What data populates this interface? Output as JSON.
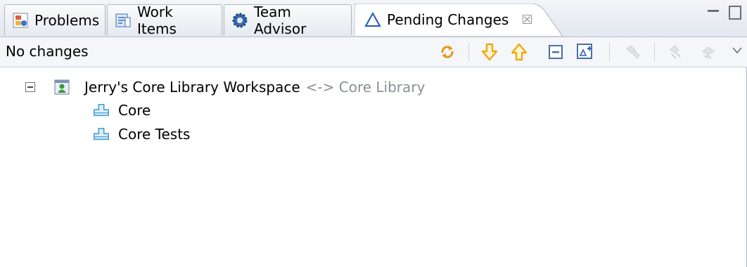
{
  "tabs": [
    {
      "label": "Problems",
      "icon": "problems-icon",
      "active": false
    },
    {
      "label": "Work Items",
      "icon": "work-items-icon",
      "active": false
    },
    {
      "label": "Team Advisor",
      "icon": "gear-icon",
      "active": false
    },
    {
      "label": "Pending Changes",
      "icon": "delta-icon",
      "active": true
    }
  ],
  "active_tab_close": "☒",
  "toolbar": {
    "status": "No changes",
    "buttons": [
      "refresh-icon",
      "accept-incoming-icon",
      "deliver-outgoing-icon",
      "collapse-all-icon",
      "expand-all-icon",
      "disabled-action-icon",
      "disabled-action-icon",
      "disabled-action-icon"
    ]
  },
  "tree": {
    "workspace": {
      "label": "Jerry's Core Library Workspace",
      "suffix": "<-> Core Library",
      "expanded": true
    },
    "components": [
      {
        "label": "Core"
      },
      {
        "label": "Core Tests"
      }
    ]
  },
  "colors": {
    "accent": "#3a6fc4",
    "arrow": "#f0a500",
    "component": "#4aa3d9"
  }
}
